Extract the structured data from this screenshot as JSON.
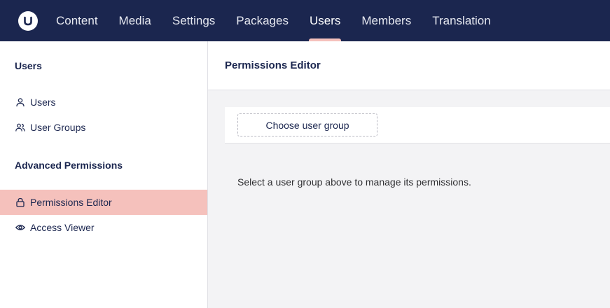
{
  "topnav": {
    "items": [
      {
        "label": "Content"
      },
      {
        "label": "Media"
      },
      {
        "label": "Settings"
      },
      {
        "label": "Packages"
      },
      {
        "label": "Users",
        "active": true
      },
      {
        "label": "Members"
      },
      {
        "label": "Translation"
      }
    ]
  },
  "sidebar": {
    "section1": "Users",
    "items1": [
      {
        "label": "Users",
        "icon": "user-icon"
      },
      {
        "label": "User Groups",
        "icon": "users-icon"
      }
    ],
    "section2": "Advanced Permissions",
    "items2": [
      {
        "label": "Permissions Editor",
        "icon": "lock-icon",
        "active": true
      },
      {
        "label": "Access Viewer",
        "icon": "eye-icon"
      }
    ]
  },
  "main": {
    "title": "Permissions Editor",
    "choose_label": "Choose user group",
    "hint": "Select a user group above to manage its permissions."
  },
  "colors": {
    "topbar": "#1b264f",
    "active_accent": "#f5c1bc",
    "main_bg": "#f3f3f5"
  }
}
